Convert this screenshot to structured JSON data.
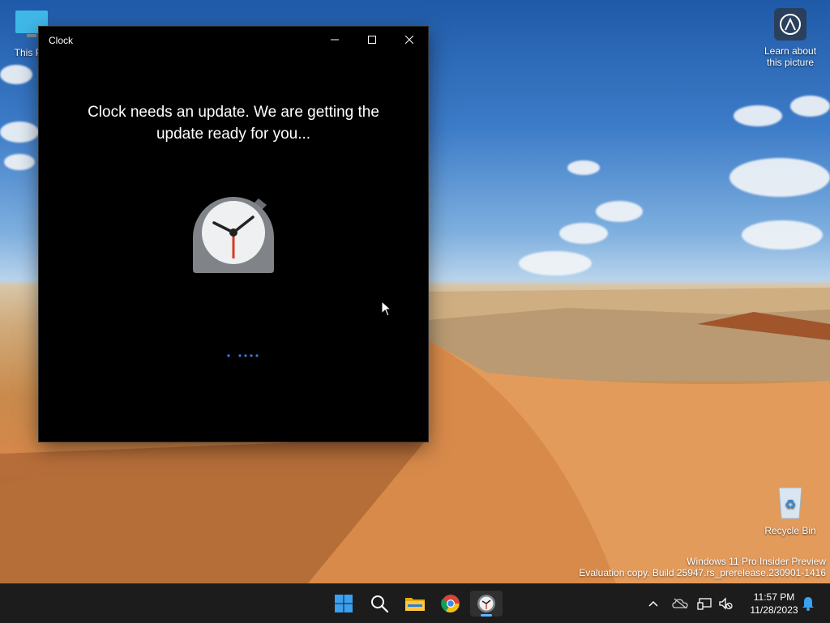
{
  "desktop": {
    "icons": [
      {
        "label": "This PC"
      },
      {
        "label": "Learn about this picture"
      },
      {
        "label": "Recycle Bin"
      }
    ],
    "watermark": {
      "line1": "Windows 11 Pro Insider Preview",
      "line2": "Evaluation copy. Build 25947.rs_prerelease.230901-1416"
    }
  },
  "window": {
    "title": "Clock",
    "message": "Clock needs an update. We are getting the update ready for you...",
    "icon": "alarm-clock-icon",
    "controls": [
      "minimize-icon",
      "maximize-icon",
      "close-icon"
    ]
  },
  "taskbar": {
    "apps": [
      "windows-start-icon",
      "search-icon",
      "file-explorer-icon",
      "chrome-icon",
      "clock-app-icon"
    ],
    "tray": [
      "chevron-up-icon",
      "onedrive-icon",
      "network-icon",
      "volume-muted-icon",
      "notification-bell-icon"
    ],
    "time": "11:57 PM",
    "date": "11/28/2023"
  },
  "colors": {
    "accent": "#2f7fe0",
    "window_bg": "#000000",
    "taskbar_bg": "#1c1c1c"
  }
}
